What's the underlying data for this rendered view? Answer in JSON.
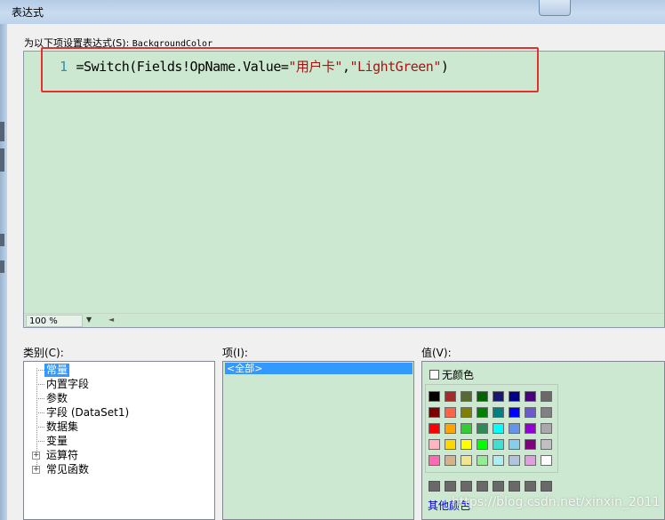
{
  "window": {
    "title": "表达式"
  },
  "expression": {
    "label": "为以下项设置表达式(S):",
    "property": "BackgroundColor",
    "line_number": "1",
    "code_prefix": "=Switch(Fields!OpName.Value=",
    "string1": "\"用户卡\"",
    "comma": ",",
    "string2": "\"LightGreen\"",
    "suffix": ")",
    "zoom": "100 %"
  },
  "category": {
    "label": "类别(C):",
    "items": [
      "常量",
      "内置字段",
      "参数",
      "字段 (DataSet1)",
      "数据集",
      "变量",
      "运算符",
      "常见函数"
    ],
    "selected_index": 0
  },
  "items_pane": {
    "label": "项(I):",
    "selected": "<全部>"
  },
  "values_pane": {
    "label": "值(V):",
    "no_color": "无颜色",
    "more_colors": "其他颜色",
    "swatch_colors": [
      [
        "#000000",
        "#a52a2a",
        "#556b2f",
        "#006400",
        "#191970",
        "#00008b",
        "#4b0082",
        "#696969"
      ],
      [
        "#800000",
        "#ff6347",
        "#808000",
        "#008000",
        "#008080",
        "#0000ff",
        "#6a5acd",
        "#808080"
      ],
      [
        "#ff0000",
        "#ffa500",
        "#32cd32",
        "#2e8b57",
        "#00ffff",
        "#6495ed",
        "#9400d3",
        "#a9a9a9"
      ],
      [
        "#ffb6c1",
        "#ffd700",
        "#ffff00",
        "#00ff00",
        "#40e0d0",
        "#87ceeb",
        "#800080",
        "#c0c0c0"
      ],
      [
        "#ff69b4",
        "#d2b48c",
        "#f0e68c",
        "#90ee90",
        "#afeeee",
        "#b0c4de",
        "#dda0dd",
        "#ffffff"
      ],
      [
        "#696969",
        "#696969",
        "#696969",
        "#696969",
        "#696969",
        "#696969",
        "#696969",
        "#696969"
      ]
    ]
  },
  "watermark": "https://blog.csdn.net/xinxin_2011"
}
